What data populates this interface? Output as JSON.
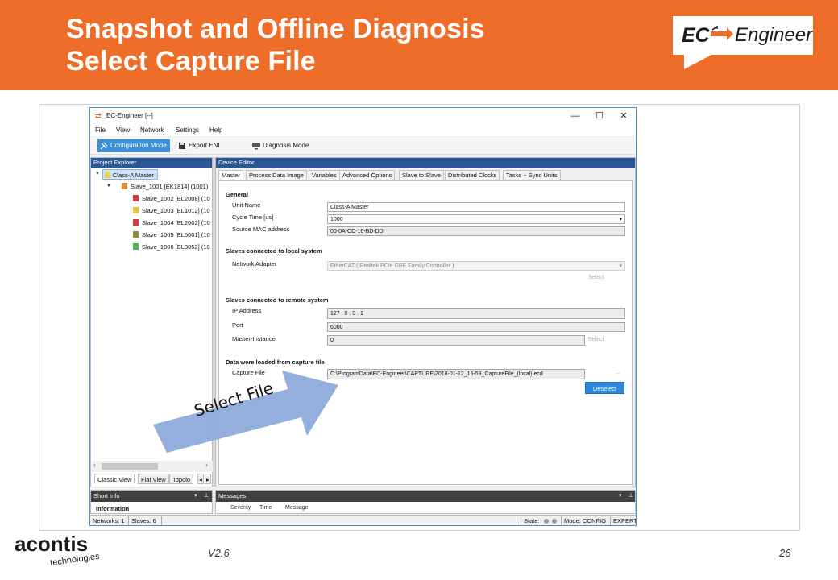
{
  "slide": {
    "title_line1": "Snapshot and Offline Diagnosis",
    "title_line2": "Select Capture File",
    "logo_left": "EC",
    "logo_right": "Engineer",
    "version": "V2.6",
    "page_number": "26",
    "company": "acontis",
    "company_sub": "technologies",
    "annotation": "Select File",
    "colors": {
      "header": "#ed6d29",
      "arrow": "#8eaadb",
      "accent": "#3c8fd9"
    }
  },
  "window": {
    "title": "EC-Engineer [--]",
    "menu": [
      "File",
      "View",
      "Network",
      "Settings",
      "Help"
    ],
    "toolbar": {
      "config_mode": "Configuration Mode",
      "export_eni": "Export ENI",
      "diagnosis_mode": "Diagnosis Mode"
    },
    "project_explorer": {
      "header": "Project Explorer",
      "master": "Class-A Master",
      "root_slave": "Slave_1001 [EK1814] (1001)",
      "slaves": [
        "Slave_1002 [EL2008] (10",
        "Slave_1003 [EL1012] (10",
        "Slave_1004 [EL2002] (10",
        "Slave_1005 [EL5001] (10",
        "Slave_1006 [EL3052] (10"
      ],
      "tabs": [
        "Classic View",
        "Flat View",
        "Topolo"
      ]
    },
    "device_editor": {
      "header": "Device Editor",
      "tabs": [
        "Master",
        "Process Data Image",
        "Variables",
        "Advanced Options",
        "Slave to Slave",
        "Distributed Clocks",
        "Tasks + Sync Units"
      ],
      "general": {
        "heading": "General",
        "unit_name_label": "Unit Name",
        "unit_name": "Class-A Master",
        "cycle_time_label": "Cycle Time [us]",
        "cycle_time": "1000",
        "mac_label": "Source MAC address",
        "mac": "00-0A-CD-16-BD-DD"
      },
      "local": {
        "heading": "Slaves connected to local system",
        "adapter_label": "Network Adapter",
        "adapter": "EtherCAT ( Realtek PCIe GBE Family Controller )",
        "select": "Select"
      },
      "remote": {
        "heading": "Slaves connected to remote system",
        "ip_label": "IP Address",
        "ip": "127 .  0  .  0  .  1",
        "port_label": "Port",
        "port": "6000",
        "instance_label": "Master-Instance",
        "instance": "0",
        "select": "Select"
      },
      "capture": {
        "heading": "Data were loaded from capture file",
        "file_label": "Capture File",
        "file": "C:\\ProgramData\\EC-Engineer\\CAPTURE\\2018-01-12_15-59_CaptureFile_(local).ecd",
        "browse": "...",
        "deselect": "Deselect"
      }
    },
    "short_info": {
      "header": "Short Info",
      "information": "Information"
    },
    "messages": {
      "header": "Messages",
      "columns": [
        "Severity",
        "Time",
        "Message"
      ]
    },
    "status": {
      "networks": "Networks: 1",
      "slaves": "Slaves: 6",
      "state": "State:",
      "mode": "Mode: CONFIG",
      "level": "EXPERT"
    }
  }
}
